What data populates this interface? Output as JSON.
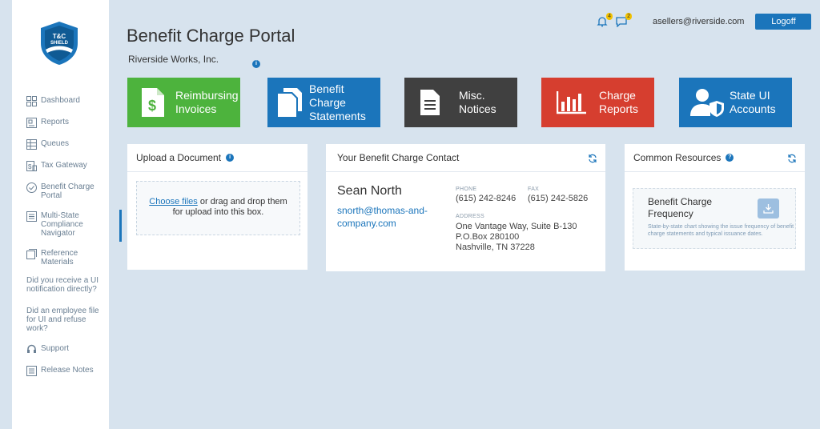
{
  "logo": {
    "line1": "T&C",
    "line2": "SHIELD"
  },
  "sidebar": {
    "items": [
      {
        "label": "Dashboard",
        "icon": "dashboard-icon"
      },
      {
        "label": "Reports",
        "icon": "reports-icon"
      },
      {
        "label": "Queues",
        "icon": "queues-icon"
      },
      {
        "label": "Tax Gateway",
        "icon": "tax-gateway-icon"
      },
      {
        "label": "Benefit Charge Portal",
        "icon": "check-circle-icon"
      },
      {
        "label": "Multi-State Compliance Navigator",
        "icon": "navigator-icon"
      },
      {
        "label": "Reference Materials",
        "icon": "reference-icon"
      }
    ],
    "questions": [
      "Did you receive a UI notification directly?",
      "Did an employee file for UI and refuse work?"
    ],
    "bottom_items": [
      {
        "label": "Support",
        "icon": "headset-icon"
      },
      {
        "label": "Release Notes",
        "icon": "notes-icon"
      }
    ]
  },
  "header": {
    "title": "Benefit Charge Portal",
    "company": "Riverside Works, Inc.",
    "notifications_count": "4",
    "messages_count": "2",
    "user_email": "asellers@riverside.com",
    "logoff_label": "Logoff"
  },
  "tiles": [
    {
      "line1": "Reimbursing",
      "line2": "Invoices",
      "color": "#4db33d"
    },
    {
      "line1": "Benefit Charge",
      "line2": "Statements",
      "color": "#1b75bb"
    },
    {
      "line1": "Misc.",
      "line2": "Notices",
      "color": "#404040"
    },
    {
      "line1": "Charge",
      "line2": "Reports",
      "color": "#d63e2f"
    },
    {
      "line1": "State UI",
      "line2": "Accounts",
      "color": "#1b75bb"
    }
  ],
  "upload": {
    "title": "Upload a Document",
    "link_text": "Choose files",
    "text1": " or drag and drop them",
    "text2": "for upload into this box."
  },
  "contact": {
    "title": "Your Benefit Charge Contact",
    "name": "Sean North",
    "email": "snorth@thomas-and-company.com",
    "phone_label": "PHONE",
    "phone": "(615) 242-8246",
    "fax_label": "FAX",
    "fax": "(615) 242-5826",
    "address_label": "ADDRESS",
    "address_line1": "One Vantage Way, Suite B-130",
    "address_line2": "P.O.Box 280100",
    "address_line3": "Nashville, TN 37228"
  },
  "resources": {
    "title": "Common Resources",
    "item_title": "Benefit Charge Frequency",
    "item_desc": "State-by-state chart showing the issue frequency of benefit charge statements and typical issuance dates."
  }
}
